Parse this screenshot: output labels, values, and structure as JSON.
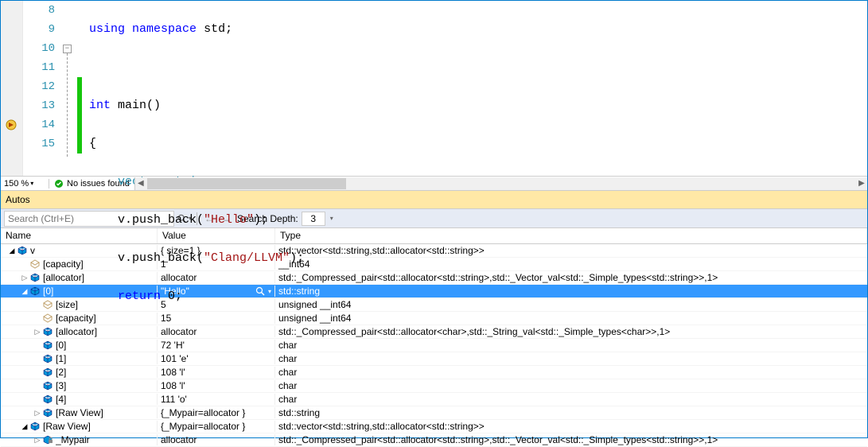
{
  "editor": {
    "lines": [
      {
        "n": 8,
        "code": "using namespace std;"
      },
      {
        "n": 9,
        "code": ""
      },
      {
        "n": 10,
        "code": "int main()"
      },
      {
        "n": 11,
        "code": "{"
      },
      {
        "n": 12,
        "code": "    vector<string> v;"
      },
      {
        "n": 13,
        "code": "    v.push_back(\"Hello\");"
      },
      {
        "n": 14,
        "code": "    v.push_back(\"Clang/LLVM\");"
      },
      {
        "n": 15,
        "code": "    return 0;"
      }
    ],
    "zoom": "150 %",
    "issues_label": "No issues found"
  },
  "autos": {
    "title": "Autos",
    "search_placeholder": "Search (Ctrl+E)",
    "depth_label": "Search Depth:",
    "depth_value": "3",
    "headers": {
      "name": "Name",
      "value": "Value",
      "type": "Type"
    },
    "rows": [
      {
        "indent": 0,
        "exp": "open",
        "icon": "cube",
        "name": "v",
        "value": "{ size=1 }",
        "type": "std::vector<std::string,std::allocator<std::string>>",
        "sel": false
      },
      {
        "indent": 1,
        "exp": "none",
        "icon": "prop",
        "name": "[capacity]",
        "value": "1",
        "type": "__int64",
        "sel": false
      },
      {
        "indent": 1,
        "exp": "closed",
        "icon": "cube",
        "name": "[allocator]",
        "value": "allocator",
        "type": "std::_Compressed_pair<std::allocator<std::string>,std::_Vector_val<std::_Simple_types<std::string>>,1>",
        "sel": false
      },
      {
        "indent": 1,
        "exp": "open",
        "icon": "cube",
        "name": "[0]",
        "value": "\"Hello\"",
        "type": "std::string",
        "sel": true,
        "mag": true
      },
      {
        "indent": 2,
        "exp": "none",
        "icon": "prop",
        "name": "[size]",
        "value": "5",
        "type": "unsigned __int64",
        "sel": false
      },
      {
        "indent": 2,
        "exp": "none",
        "icon": "prop",
        "name": "[capacity]",
        "value": "15",
        "type": "unsigned __int64",
        "sel": false
      },
      {
        "indent": 2,
        "exp": "closed",
        "icon": "cube",
        "name": "[allocator]",
        "value": "allocator",
        "type": "std::_Compressed_pair<std::allocator<char>,std::_String_val<std::_Simple_types<char>>,1>",
        "sel": false
      },
      {
        "indent": 2,
        "exp": "none",
        "icon": "cube",
        "name": "[0]",
        "value": "72 'H'",
        "type": "char",
        "sel": false
      },
      {
        "indent": 2,
        "exp": "none",
        "icon": "cube",
        "name": "[1]",
        "value": "101 'e'",
        "type": "char",
        "sel": false
      },
      {
        "indent": 2,
        "exp": "none",
        "icon": "cube",
        "name": "[2]",
        "value": "108 'l'",
        "type": "char",
        "sel": false
      },
      {
        "indent": 2,
        "exp": "none",
        "icon": "cube",
        "name": "[3]",
        "value": "108 'l'",
        "type": "char",
        "sel": false
      },
      {
        "indent": 2,
        "exp": "none",
        "icon": "cube",
        "name": "[4]",
        "value": "111 'o'",
        "type": "char",
        "sel": false
      },
      {
        "indent": 2,
        "exp": "closed",
        "icon": "cube",
        "name": "[Raw View]",
        "value": "{_Mypair=allocator }",
        "type": "std::string",
        "sel": false
      },
      {
        "indent": 1,
        "exp": "open",
        "icon": "cube",
        "name": "[Raw View]",
        "value": "{_Mypair=allocator }",
        "type": "std::vector<std::string,std::allocator<std::string>>",
        "sel": false
      },
      {
        "indent": 2,
        "exp": "closed",
        "icon": "cube-lock",
        "name": "_Mypair",
        "value": "allocator",
        "type": "std::_Compressed_pair<std::allocator<std::string>,std::_Vector_val<std::_Simple_types<std::string>>,1>",
        "sel": false
      }
    ]
  }
}
